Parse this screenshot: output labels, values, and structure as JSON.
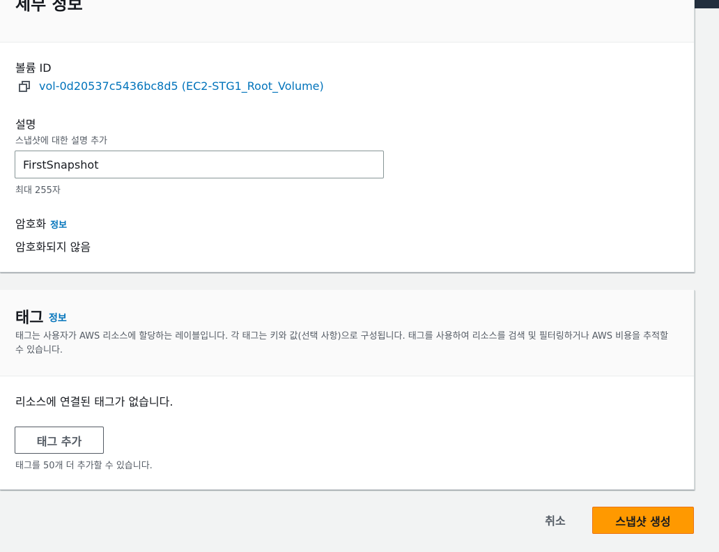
{
  "details": {
    "title": "세부 정보",
    "volume_id_label": "볼륨 ID",
    "volume_id_value": "vol-0d20537c5436bc8d5 (EC2-STG1_Root_Volume)",
    "description_label": "설명",
    "description_hint": "스냅샷에 대한 설명 추가",
    "description_value": "FirstSnapshot",
    "description_constraint": "최대 255자",
    "encryption_label": "암호화",
    "encryption_info": "정보",
    "encryption_value": "암호화되지 않음"
  },
  "tags": {
    "title": "태그",
    "info": "정보",
    "description": "태그는 사용자가 AWS 리소스에 할당하는 레이블입니다. 각 태그는 키와 값(선택 사항)으로 구성됩니다. 태그를 사용하여 리소스를 검색 및 필터링하거나 AWS 비용을 추적할 수 있습니다.",
    "empty_message": "리소스에 연결된 태그가 없습니다.",
    "add_button": "태그 추가",
    "limit_hint": "태그를 50개 더 추가할 수 있습니다."
  },
  "footer": {
    "cancel": "취소",
    "create": "스냅샷 생성"
  },
  "colors": {
    "link": "#0073bb",
    "primary": "#ff9900"
  },
  "icons": {
    "copy": "copy-icon"
  }
}
